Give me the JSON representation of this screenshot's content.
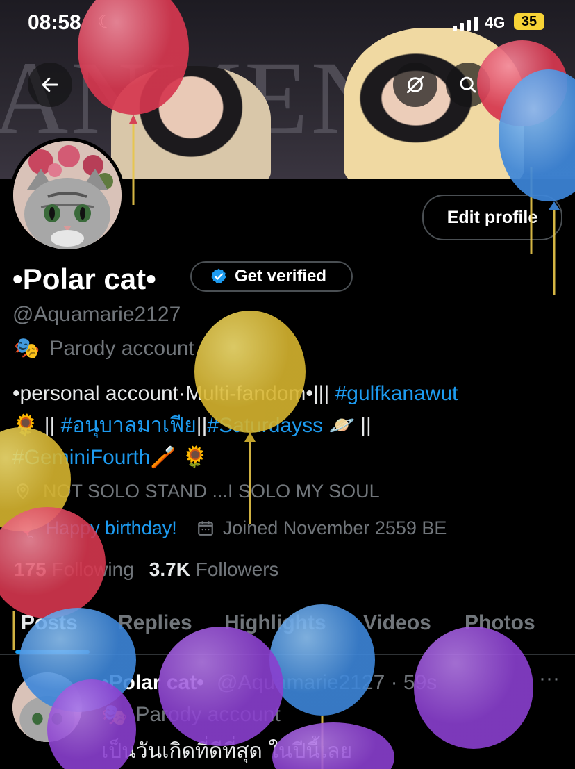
{
  "status_bar": {
    "time": "08:58",
    "network": "4G",
    "battery": "35"
  },
  "banner": {
    "text": "ANMEN"
  },
  "header_actions": {
    "back": "arrow-left-icon",
    "reload": "refresh-icon",
    "search": "search-icon"
  },
  "profile": {
    "edit_label": "Edit profile",
    "name": "•Polar cat•",
    "verify_label": "Get verified",
    "handle": "@Aquamarie2127",
    "parody_label": "Parody account",
    "bio_line1_a": "•personal account·Multi-fandom•||| ",
    "bio_tag1": "#gulfkanawut",
    "bio_line2_a": "🌻 || ",
    "bio_tag2": "#อนุบาลมาเฟีย",
    "bio_line2_b": "||",
    "bio_tag3": "#Saturdayss",
    "bio_line2_c": " 🪐 ||",
    "bio_tag4": "#GeminiFourth",
    "bio_line3_b": "🪥 🌻",
    "location": "NOT SOLO STAND ...I SOLO MY SOUL",
    "birthday": "Happy birthday!",
    "joined": "Joined November 2559 BE",
    "following_count": "175",
    "following_label": "Following",
    "followers_count": "3.7K",
    "followers_label": "Followers"
  },
  "tabs": [
    "Posts",
    "Replies",
    "Highlights",
    "Videos",
    "Photos"
  ],
  "post": {
    "name": "•Polar cat•",
    "handle": "@Aquamarie2127 · 59s",
    "parody_label": "Parody account",
    "text": "เป็นวันเกิดที่ดีที่สุด ในปีนี้เลย"
  },
  "colors": {
    "accent": "#1d9bf0",
    "muted": "#71767b",
    "background": "#000000"
  }
}
